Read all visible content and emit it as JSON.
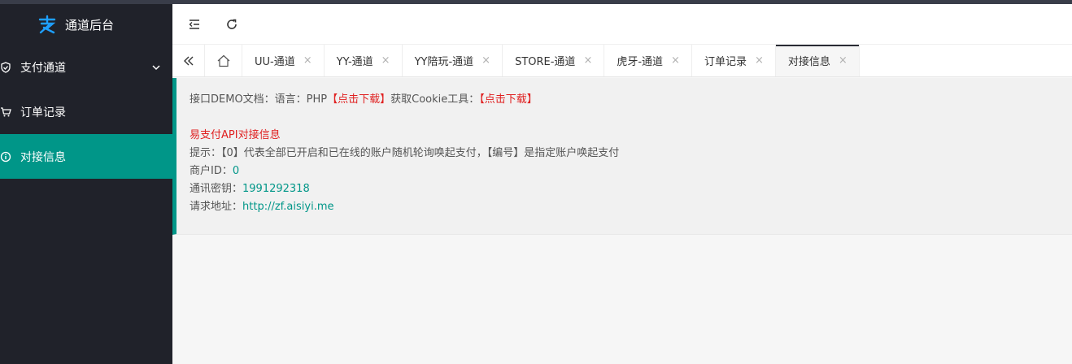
{
  "sidebar": {
    "title": "通道后台",
    "items": [
      {
        "label": "支付通道",
        "active": false,
        "has_caret": true
      },
      {
        "label": "订单记录",
        "active": false,
        "has_caret": false
      },
      {
        "label": "对接信息",
        "active": true,
        "has_caret": false
      }
    ]
  },
  "tabs": [
    {
      "label": "UU-通道",
      "active": false
    },
    {
      "label": "YY-通道",
      "active": false
    },
    {
      "label": "YY陪玩-通道",
      "active": false
    },
    {
      "label": "STORE-通道",
      "active": false
    },
    {
      "label": "虎牙-通道",
      "active": false
    },
    {
      "label": "订单记录",
      "active": false
    },
    {
      "label": "对接信息",
      "active": true
    }
  ],
  "tab_close_glyph": "×",
  "info": {
    "demo_prefix": "接口DEMO文档：语言：PHP",
    "demo_link": "【点击下载】",
    "cookie_prefix": "获取Cookie工具：",
    "cookie_link": "【点击下载】",
    "api_title": "易支付API对接信息",
    "hint": "提示：【0】代表全部已开启和已在线的账户随机轮询唤起支付，【编号】是指定账户唤起支付",
    "merchant_label": "商户ID：",
    "merchant_value": "0",
    "key_label": "通讯密钥：",
    "key_value": "1991292318",
    "url_label": "请求地址：",
    "url_value": "http://zf.aisiyi.me"
  },
  "colors": {
    "accent": "#009688",
    "sidebar_bg": "#20222a",
    "link_red": "#e02020"
  }
}
